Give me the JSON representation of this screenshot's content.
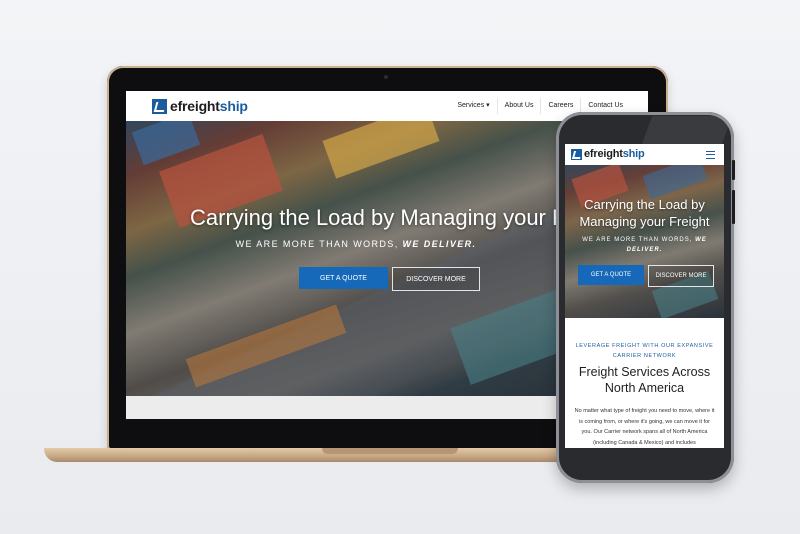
{
  "brand": {
    "name_prefix": "efreight",
    "name_suffix": "ship",
    "color": "#1b5c9e"
  },
  "laptop": {
    "nav": {
      "items": [
        {
          "label": "Services ▾"
        },
        {
          "label": "About Us"
        },
        {
          "label": "Careers"
        },
        {
          "label": "Contact Us"
        }
      ]
    },
    "hero": {
      "title": "Carrying the Load by Managing your Freight",
      "subtitle_prefix": "WE ARE MORE THAN WORDS,",
      "subtitle_emph": "WE DELIVER.",
      "primary_button": "GET A QUOTE",
      "secondary_button": "DISCOVER MORE"
    }
  },
  "phone": {
    "nav": {
      "menu_icon": "hamburger-icon"
    },
    "hero": {
      "title": "Carrying the Load by Managing your Freight",
      "subtitle_prefix": "WE ARE MORE THAN WORDS,",
      "subtitle_emph": "WE DELIVER.",
      "primary_button": "GET A QUOTE",
      "secondary_button": "DISCOVER MORE"
    },
    "section": {
      "kicker": "LEVERAGE FREIGHT WITH OUR EXPANSIVE CARRIER NETWORK",
      "heading": "Freight Services Across North America",
      "body": "No matter what type of freight you need to move, where it is coming from, or where it's going, we can move it for you. Our Carrier network spans all of North America (including Canada & Mexico) and includes"
    }
  },
  "colors": {
    "accent": "#1668b9",
    "background": "#eceef2"
  }
}
